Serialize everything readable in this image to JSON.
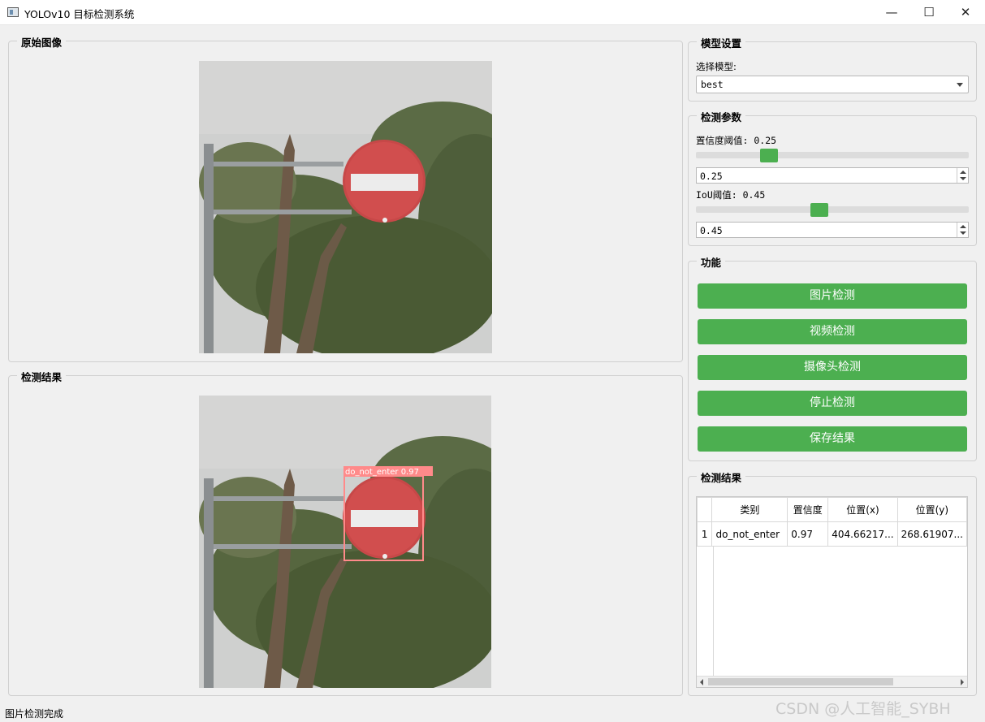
{
  "window": {
    "title": "YOLOv10 目标检测系统",
    "minimize": "—",
    "maximize": "☐",
    "close": "✕"
  },
  "panels": {
    "original_title": "原始图像",
    "result_title": "检测结果"
  },
  "detection_box": {
    "label": "do_not_enter",
    "confidence": "0.97",
    "caption": "do_not_enter 0.97",
    "color": "#ff8a8a"
  },
  "model_settings": {
    "title": "模型设置",
    "select_label": "选择模型:",
    "selected_model": "best"
  },
  "detect_params": {
    "title": "检测参数",
    "conf_label": "置信度阈值: 0.25",
    "conf_value": "0.25",
    "conf_level": 0.25,
    "iou_label": "IoU阈值: 0.45",
    "iou_value": "0.45",
    "iou_level": 0.45
  },
  "functions": {
    "title": "功能",
    "buttons": [
      "图片检测",
      "视频检测",
      "摄像头检测",
      "停止检测",
      "保存结果"
    ],
    "button_color": "#4caf50"
  },
  "results_table": {
    "title": "检测结果",
    "headers": [
      "",
      "类别",
      "置信度",
      "位置(x)",
      "位置(y)"
    ],
    "rows": [
      [
        "1",
        "do_not_enter",
        "0.97",
        "404.66217...",
        "268.61907..."
      ]
    ]
  },
  "status_bar": "图片检测完成",
  "watermark": "CSDN @人工智能_SYBH"
}
